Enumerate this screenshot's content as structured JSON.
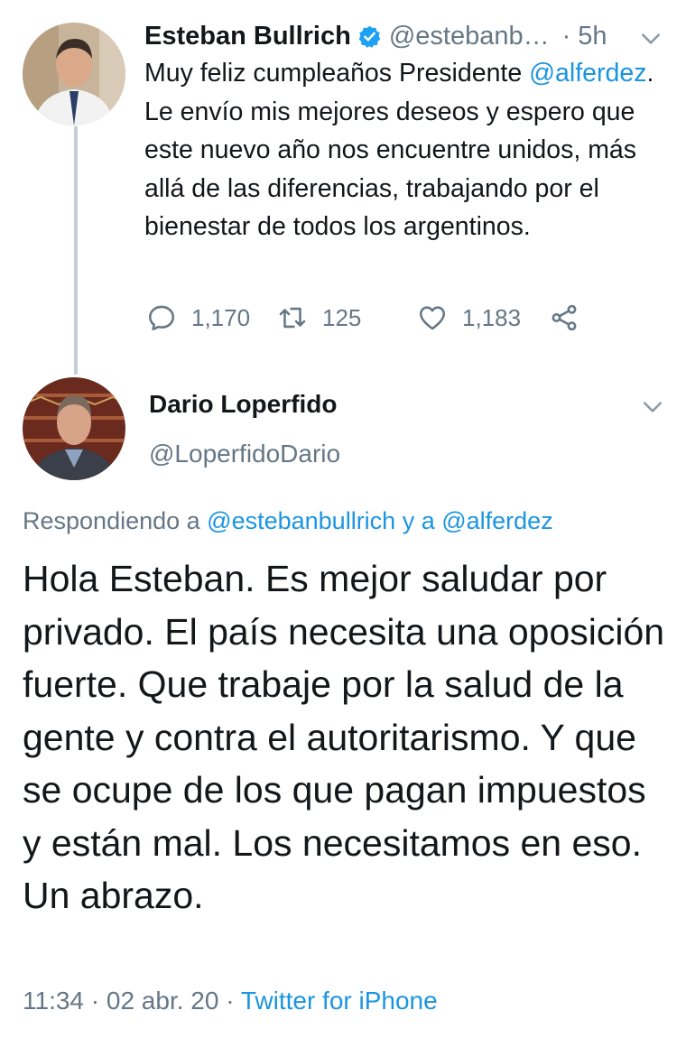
{
  "tweet1": {
    "name": "Esteban Bullrich",
    "handle": "@estebanb…",
    "separator": "·",
    "time": "5h",
    "text_before": "Muy feliz cumpleaños Presidente ",
    "mention": "@alferdez",
    "text_after": ". Le envío mis mejores deseos y espero que este nuevo año nos encuentre unidos, más allá de las diferencias, trabajando por el bienestar de todos los argentinos.",
    "replies": "1,170",
    "retweets": "125",
    "likes": "1,183"
  },
  "tweet2": {
    "name": "Dario Loperfido",
    "handle": "@LoperfidoDario",
    "replying_prefix": "Respondiendo a ",
    "replying_user1": "@estebanbullrich",
    "replying_and": " y a ",
    "replying_user2": "@alferdez",
    "text": "Hola Esteban. Es mejor saludar por privado. El país necesita una oposición fuerte. Que trabaje por la salud de la gente y contra el autoritarismo. Y que se ocupe de los que pagan impuestos y están mal. Los necesitamos en eso. Un abrazo.",
    "timestamp": "11:34 · 02 abr. 20 · ",
    "source": "Twitter for iPhone"
  },
  "icons": {
    "reply": "comment-icon",
    "retweet": "retweet-icon",
    "like": "heart-icon",
    "share": "share-icon",
    "verified": "verified-badge-icon",
    "menu": "chevron-down-icon"
  },
  "colors": {
    "link": "#1b95e0",
    "secondary": "#657786",
    "text": "#14171a",
    "thread_line": "#c4cfd6"
  }
}
